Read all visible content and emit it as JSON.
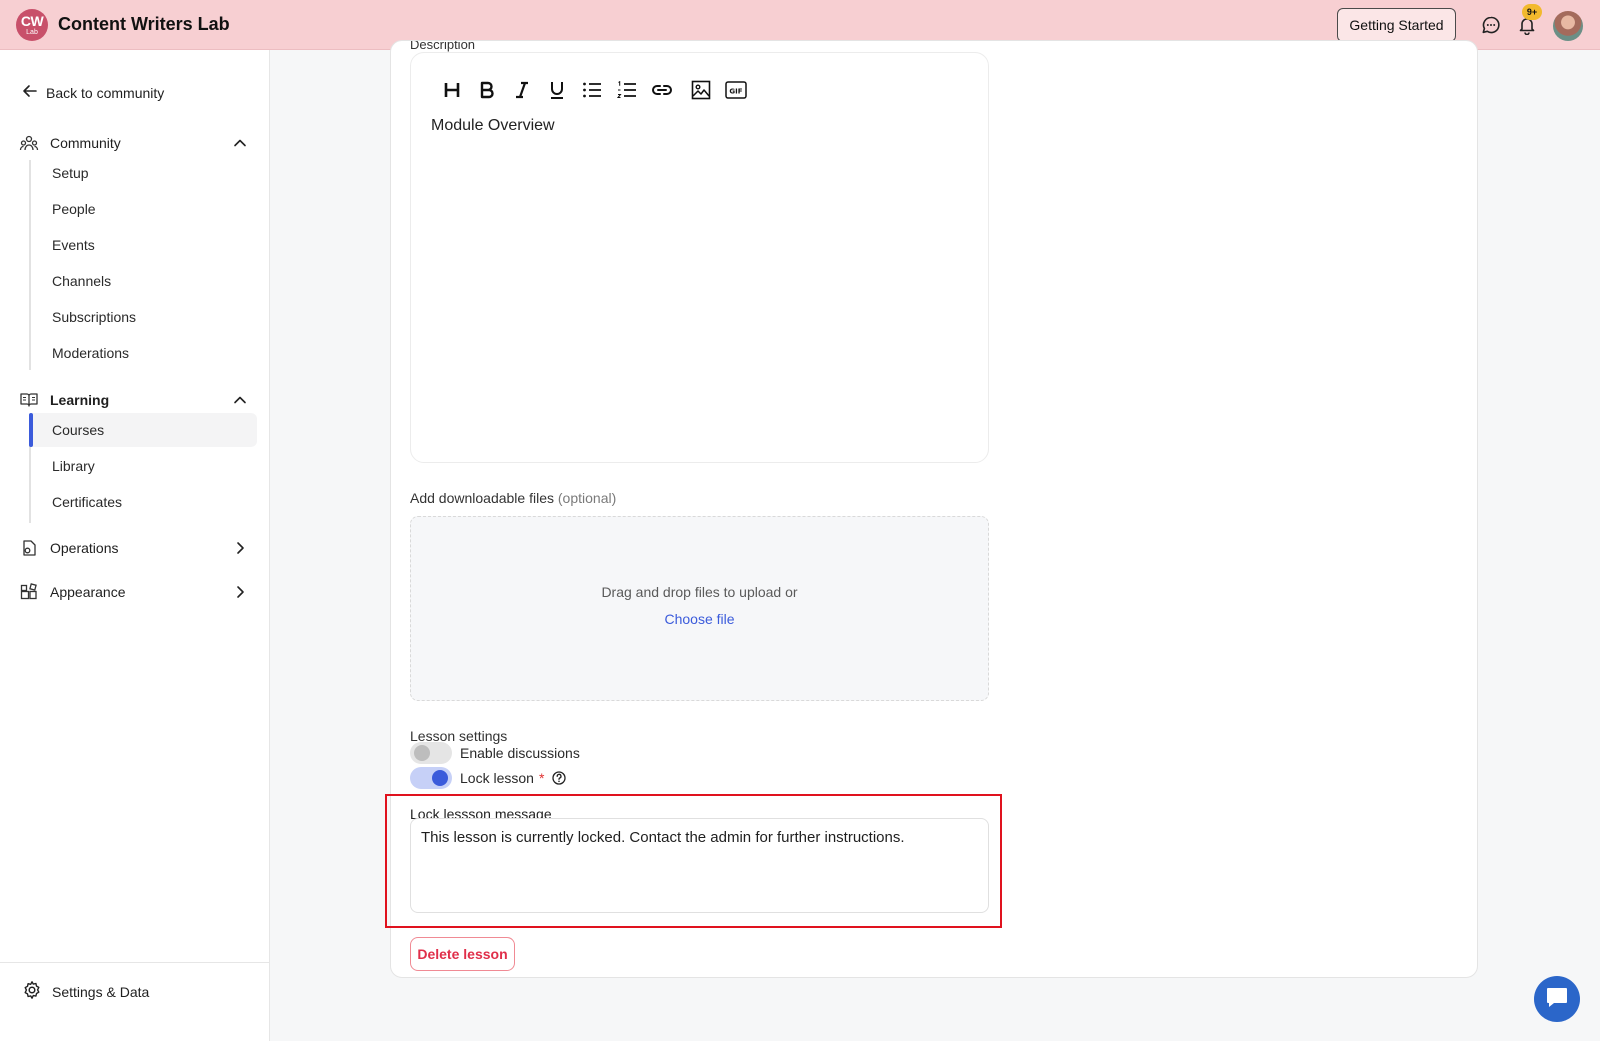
{
  "header": {
    "logo_primary": "CW",
    "logo_secondary": "Lab",
    "app_title": "Content Writers Lab",
    "getting_started_label": "Getting Started",
    "notification_badge": "9+"
  },
  "sidebar": {
    "back_label": "Back to community",
    "community": {
      "label": "Community",
      "items": [
        "Setup",
        "People",
        "Events",
        "Channels",
        "Subscriptions",
        "Moderations"
      ]
    },
    "learning": {
      "label": "Learning",
      "items": [
        "Courses",
        "Library",
        "Certificates"
      ],
      "active_item": "Courses"
    },
    "operations_label": "Operations",
    "appearance_label": "Appearance",
    "settings_label": "Settings & Data"
  },
  "editor": {
    "description_label": "Description",
    "content": "Module Overview",
    "toolbar": [
      "heading",
      "bold",
      "italic",
      "underline",
      "bullet-list",
      "numbered-list",
      "link",
      "image",
      "gif"
    ]
  },
  "files": {
    "label": "Add downloadable files",
    "optional": "(optional)",
    "drop_text": "Drag and drop files to upload or",
    "choose_label": "Choose file"
  },
  "lesson_settings": {
    "label": "Lesson settings",
    "enable_discussions_label": "Enable discussions",
    "enable_discussions_on": false,
    "lock_lesson_label": "Lock lesson",
    "lock_lesson_required": "*",
    "lock_lesson_on": true
  },
  "lock_message": {
    "label": "Lock lessson message",
    "value": "This lesson is currently locked. Contact the admin for further instructions."
  },
  "delete_label": "Delete lesson",
  "colors": {
    "header_bg": "#f7cfd2",
    "accent": "#3b5bdb",
    "danger": "#e02f4a",
    "highlight": "#e0121e"
  }
}
